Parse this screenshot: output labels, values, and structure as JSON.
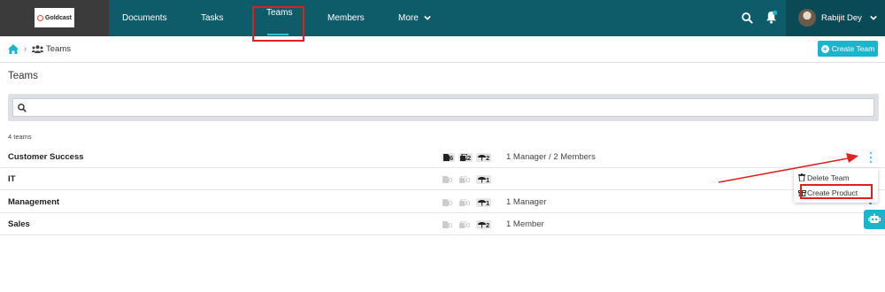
{
  "header": {
    "logo_text": "Goldcast",
    "nav": [
      {
        "label": "Documents"
      },
      {
        "label": "Tasks"
      },
      {
        "label": "Teams"
      },
      {
        "label": "Members"
      },
      {
        "label": "More"
      }
    ],
    "user_name": "Rabijit Dey",
    "icons": [
      "search-icon",
      "bell-icon",
      "chevron-down-icon",
      "avatar"
    ]
  },
  "breadcrumb": {
    "home_icon": "home-icon",
    "current": "Teams"
  },
  "actions": {
    "create_team_label": "Create Team"
  },
  "page": {
    "title": "Teams",
    "search_placeholder": "",
    "count_text": "4 teams"
  },
  "teams": [
    {
      "name": "Customer Success",
      "documents": "6",
      "products": "2",
      "managers": "2",
      "summary": "1 Manager / 2 Members"
    },
    {
      "name": "IT",
      "documents": "0",
      "products": "0",
      "managers": "1",
      "summary": ""
    },
    {
      "name": "Management",
      "documents": "0",
      "products": "0",
      "managers": "1",
      "summary": "1 Manager"
    },
    {
      "name": "Sales",
      "documents": "0",
      "products": "0",
      "managers": "2",
      "summary": "1 Member"
    }
  ],
  "context_menu": {
    "items": [
      {
        "label": "Delete Team",
        "icon": "trash-icon"
      },
      {
        "label": "Create Product",
        "icon": "gift-icon"
      }
    ]
  },
  "colors": {
    "topbar": "#0e5b69",
    "accent": "#1ab5cc",
    "annotation": "#e02020"
  }
}
